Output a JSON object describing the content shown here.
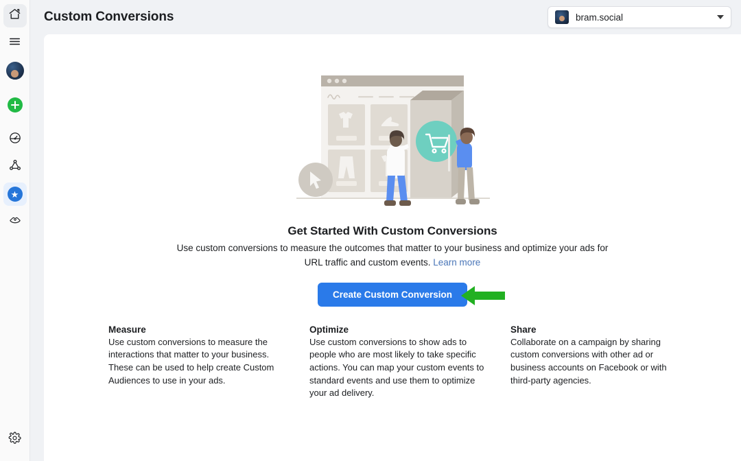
{
  "header": {
    "title": "Custom Conversions",
    "account": {
      "name": "bram.social",
      "avatar_icon": "user-avatar-thumbnail",
      "caret_icon": "chevron-down-icon"
    }
  },
  "sidebar": {
    "items": [
      {
        "icon": "home-icon",
        "name": "home",
        "state": "selected-light"
      },
      {
        "icon": "hamburger-menu-icon",
        "name": "menu",
        "state": "default"
      },
      {
        "icon": "user-avatar-icon",
        "name": "profile",
        "state": "default"
      },
      {
        "icon": "plus-circle-icon",
        "name": "create",
        "state": "default"
      },
      {
        "icon": "gauge-icon",
        "name": "performance",
        "state": "default"
      },
      {
        "icon": "network-nodes-icon",
        "name": "connections",
        "state": "default"
      },
      {
        "icon": "star-circle-icon",
        "name": "custom-conversions",
        "state": "selected-blue"
      },
      {
        "icon": "handshake-icon",
        "name": "partnerships",
        "state": "default"
      }
    ],
    "bottom": {
      "icon": "gear-icon",
      "name": "settings"
    }
  },
  "hero": {
    "illustration_name": "storefront-shopping-illustration",
    "illustration_parts": {
      "cart_badge_icon": "shopping-cart-icon",
      "cursor_badge_icon": "cursor-pointer-icon"
    },
    "heading": "Get Started With Custom Conversions",
    "description": "Use custom conversions to measure the outcomes that matter to your business and optimize your ads for URL traffic and custom events.",
    "learn_more": "Learn more",
    "cta_label": "Create Custom Conversion",
    "annotation_icon": "green-left-arrow-annotation"
  },
  "columns": [
    {
      "title": "Measure",
      "body": "Use custom conversions to measure the interactions that matter to your business. These can be used to help create Custom Audiences to use in your ads."
    },
    {
      "title": "Optimize",
      "body": "Use custom conversions to show ads to people who are most likely to take specific actions. You can map your custom events to standard events and use them to optimize your ad delivery."
    },
    {
      "title": "Share",
      "body": "Collaborate on a campaign by sharing custom conversions with other ad or business accounts on Facebook or with third-party agencies."
    }
  ],
  "colors": {
    "page_background": "#f0f2f5",
    "card_background": "#ffffff",
    "cta_blue": "#2a7ae9",
    "link_blue": "#4a76b8",
    "annotation_green": "#22b022",
    "cart_teal": "#6ecfc0",
    "active_star_blue": "#2676d9",
    "plus_green": "#21ba45"
  }
}
